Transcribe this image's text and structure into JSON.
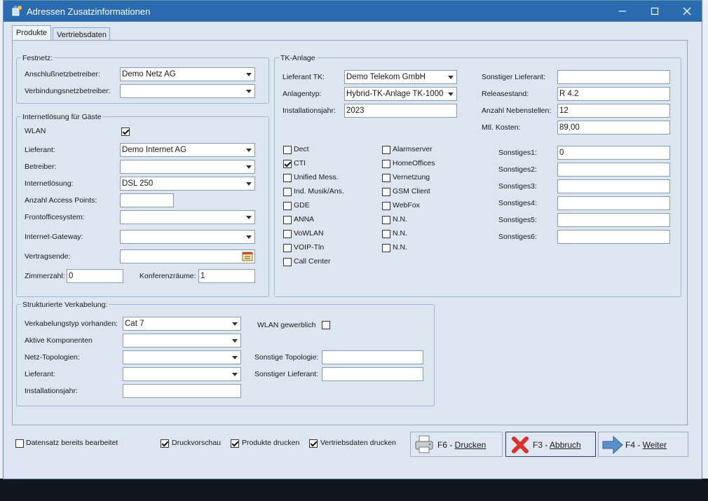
{
  "window": {
    "title": "Adressen Zusatzinformationen"
  },
  "tabs": [
    {
      "label": "Produkte"
    },
    {
      "label": "Vertriebsdaten"
    }
  ],
  "festnetz": {
    "group_label": "Festnetz:",
    "anschluss_label": "Anschlußnetzbetreiber:",
    "anschluss_value": "Demo Netz AG",
    "verbindung_label": "Verbindungsnetzbetreiber:",
    "verbindung_value": ""
  },
  "internet": {
    "group_label": "Internetlösung für Gäste",
    "wlan_label": "WLAN",
    "wlan_checked": true,
    "lieferant_label": "Lieferant:",
    "lieferant_value": "Demo Internet AG",
    "betreiber_label": "Betreiber:",
    "betreiber_value": "",
    "loesung_label": "Internetlösung:",
    "loesung_value": "DSL 250",
    "ap_label": "Anzahl Access Points:",
    "ap_value": "",
    "frontoffice_label": "Frontofficesystem:",
    "frontoffice_value": "",
    "gateway_label": "Internet-Gateway:",
    "gateway_value": "",
    "vertragsende_label": "Vertragsende:",
    "vertragsende_value": "",
    "zimmer_label": "Zimmerzahl:",
    "zimmer_value": "0",
    "konferenz_label": "Konferenzräume:",
    "konferenz_value": "1"
  },
  "tk": {
    "group_label": "TK-Anlage",
    "lieferant_label": "Lieferant TK:",
    "lieferant_value": "Demo Telekom GmbH",
    "anlagentyp_label": "Anlagentyp:",
    "anlagentyp_value": "Hybrid-TK-Anlage TK-1000",
    "install_label": "Installationsjahr:",
    "install_value": "2023",
    "sonst_lief_label": "Sonstiger Lieferant:",
    "sonst_lief_value": "",
    "release_label": "Releasestand:",
    "release_value": "R 4.2",
    "nebenstellen_label": "Anzahl Nebenstellen:",
    "nebenstellen_value": "12",
    "kosten_label": "Mtl. Kosten:",
    "kosten_value": "89,00",
    "checks_left": [
      {
        "label": "Dect",
        "checked": false
      },
      {
        "label": "CTI",
        "checked": true
      },
      {
        "label": "Unified Mess.",
        "checked": false
      },
      {
        "label": "Ind. Musik/Ans.",
        "checked": false
      },
      {
        "label": "GDE",
        "checked": false
      },
      {
        "label": "ANNA",
        "checked": false
      },
      {
        "label": "VoWLAN",
        "checked": false
      },
      {
        "label": "VOIP-Tln",
        "checked": false
      },
      {
        "label": "Call Center",
        "checked": false
      }
    ],
    "checks_right": [
      {
        "label": "Alarmserver",
        "checked": false
      },
      {
        "label": "HomeOffices",
        "checked": false
      },
      {
        "label": "Vernetzung",
        "checked": false
      },
      {
        "label": "GSM Client",
        "checked": false
      },
      {
        "label": "WebFox",
        "checked": false
      },
      {
        "label": "N.N.",
        "checked": false
      },
      {
        "label": "N.N.",
        "checked": false
      },
      {
        "label": "N.N.",
        "checked": false
      }
    ],
    "sonstiges": [
      {
        "label": "Sonstiges1:",
        "value": "0"
      },
      {
        "label": "Sonstiges2:",
        "value": ""
      },
      {
        "label": "Sonstiges3:",
        "value": ""
      },
      {
        "label": "Sonstiges4:",
        "value": ""
      },
      {
        "label": "Sonstiges5:",
        "value": ""
      },
      {
        "label": "Sonstiges6:",
        "value": ""
      }
    ]
  },
  "verkabelung": {
    "group_label": "Strukturierte Verkabelung:",
    "typ_label": "Verkabelungstyp vorhanden:",
    "typ_value": "Cat 7",
    "aktive_label": "Aktive Komponenten",
    "aktive_value": "",
    "topo_label": "Netz-Topologien:",
    "topo_value": "",
    "lieferant_label": "Lieferant:",
    "lieferant_value": "",
    "install_label": "Installationsjahr:",
    "install_value": "",
    "wlan_gew_label": "WLAN gewerblich",
    "wlan_gew_checked": false,
    "sonst_topo_label": "Sonstige Topologie:",
    "sonst_topo_value": "",
    "sonst_lief_label": "Sonstiger Lieferant:",
    "sonst_lief_value": ""
  },
  "footer": {
    "bearbeitet_label": "Datensatz bereits bearbeitet",
    "bearbeitet_checked": false,
    "druckvorschau_label": "Druckvorschau",
    "druckvorschau_checked": true,
    "produkte_label": "Produkte drucken",
    "produkte_checked": true,
    "vertrieb_label": "Vertriebsdaten drucken",
    "vertrieb_checked": true
  },
  "buttons": {
    "print_key": "F6 - ",
    "print_label": "Drucken",
    "cancel_key": "F3 - ",
    "cancel_label": "Abbruch",
    "next_key": "F4 - ",
    "next_label": "Weiter"
  }
}
